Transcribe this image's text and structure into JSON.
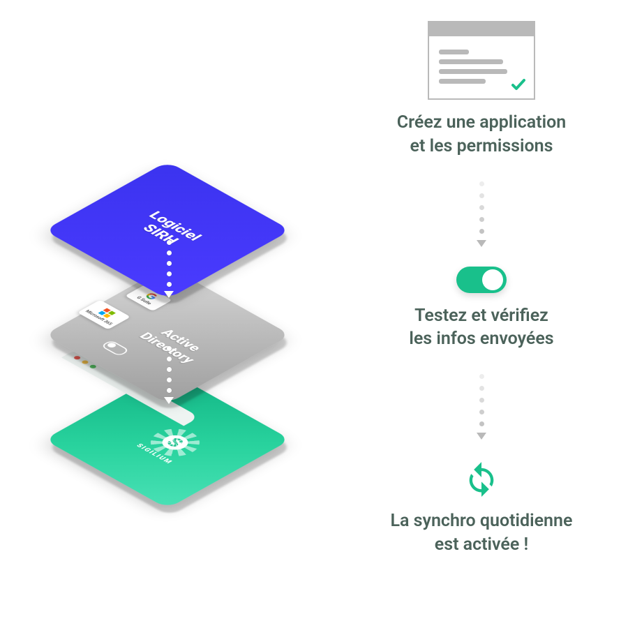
{
  "diagram": {
    "layers": {
      "top": {
        "title": "Logiciel\nSIRH"
      },
      "middle": {
        "title": "Active\nDirectory",
        "providers": [
          {
            "id": "microsoft-365",
            "label": "Microsoft 365"
          },
          {
            "id": "g-suite",
            "label": "G Suite"
          }
        ]
      },
      "bottom": {
        "title": "SIGILIUM"
      }
    }
  },
  "steps": [
    {
      "icon": "form-window",
      "text": "Créez une application\net les permissions"
    },
    {
      "icon": "toggle-on",
      "text": "Testez et vérifiez\nles infos envoyées"
    },
    {
      "icon": "sync",
      "text": "La synchro quotidienne\nest activée !"
    }
  ],
  "colors": {
    "text": "#4b625a",
    "accent": "#19c08b",
    "top": "#3b33ef",
    "mid": "#b6b6b6",
    "bot": "#17bf8c"
  }
}
